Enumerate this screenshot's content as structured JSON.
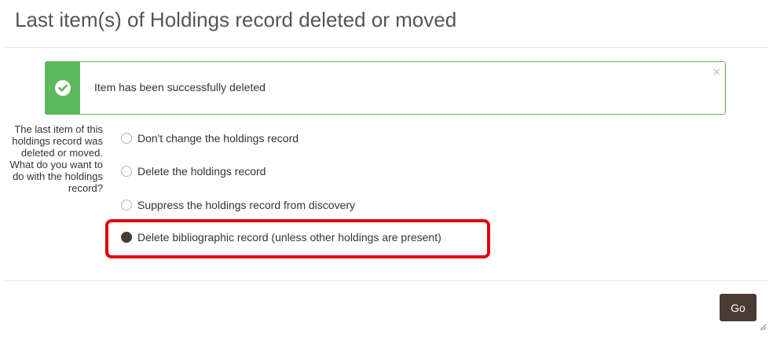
{
  "modal": {
    "title": "Last item(s) of Holdings record deleted or moved"
  },
  "alert": {
    "message": "Item has been successfully deleted",
    "close_symbol": "×",
    "status_icon": "check-circle-icon",
    "status_color": "#5cb85c"
  },
  "question": {
    "label": "The last item of this holdings record was deleted or moved. What do you want to do with the holdings record?"
  },
  "options": [
    {
      "label": "Don't change the holdings record",
      "selected": false
    },
    {
      "label": "Delete the holdings record",
      "selected": false
    },
    {
      "label": "Suppress the holdings record from discovery",
      "selected": false
    },
    {
      "label": "Delete bibliographic record (unless other holdings are present)",
      "selected": true
    }
  ],
  "footer": {
    "go_label": "Go"
  },
  "colors": {
    "accent": "#4a3b34",
    "highlight": "#e0000f"
  }
}
